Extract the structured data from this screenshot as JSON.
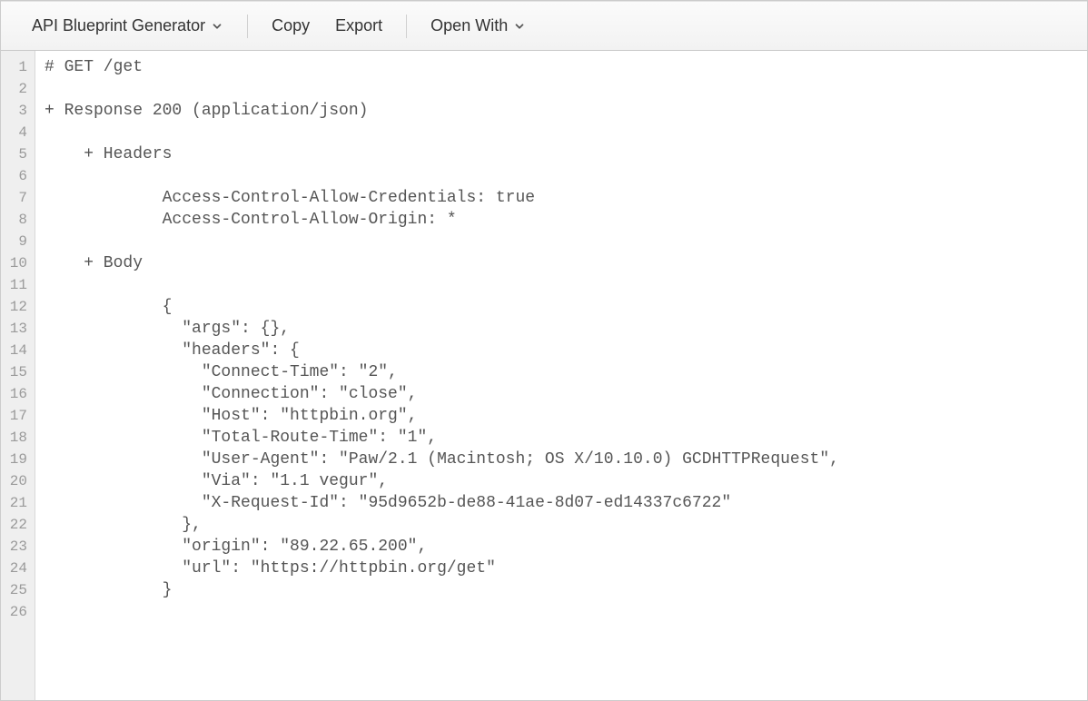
{
  "toolbar": {
    "generator_label": "API Blueprint Generator",
    "copy_label": "Copy",
    "export_label": "Export",
    "open_with_label": "Open With"
  },
  "code_lines": [
    "# GET /get",
    "",
    "+ Response 200 (application/json)",
    "",
    "    + Headers",
    "",
    "            Access-Control-Allow-Credentials: true",
    "            Access-Control-Allow-Origin: *",
    "",
    "    + Body",
    "",
    "            {",
    "              \"args\": {},",
    "              \"headers\": {",
    "                \"Connect-Time\": \"2\",",
    "                \"Connection\": \"close\",",
    "                \"Host\": \"httpbin.org\",",
    "                \"Total-Route-Time\": \"1\",",
    "                \"User-Agent\": \"Paw/2.1 (Macintosh; OS X/10.10.0) GCDHTTPRequest\",",
    "                \"Via\": \"1.1 vegur\",",
    "                \"X-Request-Id\": \"95d9652b-de88-41ae-8d07-ed14337c6722\"",
    "              },",
    "              \"origin\": \"89.22.65.200\",",
    "              \"url\": \"https://httpbin.org/get\"",
    "            }",
    ""
  ]
}
